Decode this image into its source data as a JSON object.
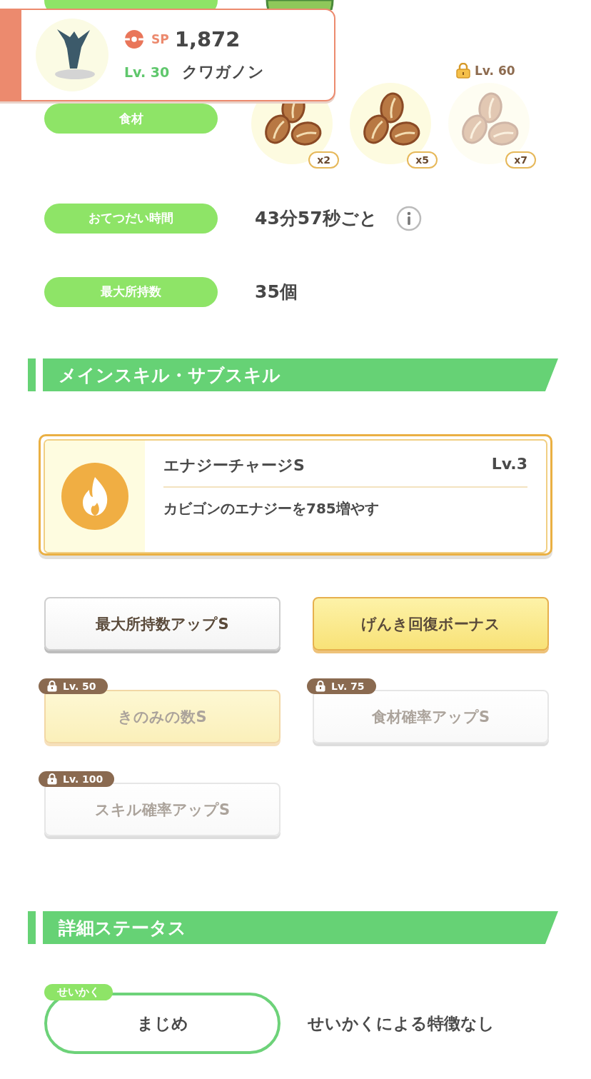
{
  "header": {
    "sp_label": "SP",
    "sp": "1,872",
    "level": "Lv. 30",
    "name": "クワガノン"
  },
  "ingredients": {
    "label": "食材",
    "items": [
      {
        "count": "x2",
        "locked": false
      },
      {
        "count": "x5",
        "locked": false
      },
      {
        "count": "x7",
        "locked": true,
        "unlock": "Lv. 60"
      }
    ]
  },
  "stats": [
    {
      "label": "おてつだい時間",
      "value": "43分57秒ごと",
      "info": true
    },
    {
      "label": "最大所持数",
      "value": "35個"
    }
  ],
  "skills_section": {
    "title": "メインスキル・サブスキル"
  },
  "main_skill": {
    "name": "エナジーチャージS",
    "level": "Lv.3",
    "description": "カビゴンのエナジーを785増やす"
  },
  "sub_skills": [
    {
      "name": "最大所持数アップS",
      "highlighted": false,
      "locked": false
    },
    {
      "name": "げんき回復ボーナス",
      "highlighted": true,
      "locked": false
    },
    {
      "name": "きのみの数S",
      "highlighted": true,
      "locked": true,
      "unlock": "Lv. 50"
    },
    {
      "name": "食材確率アップS",
      "highlighted": false,
      "locked": true,
      "unlock": "Lv. 75"
    },
    {
      "name": "スキル確率アップS",
      "highlighted": false,
      "locked": true,
      "unlock": "Lv. 100"
    }
  ],
  "status_section": {
    "title": "詳細ステータス"
  },
  "nature": {
    "tag": "せいかく",
    "name": "まじめ",
    "effect": "せいかくによる特徴なし"
  }
}
